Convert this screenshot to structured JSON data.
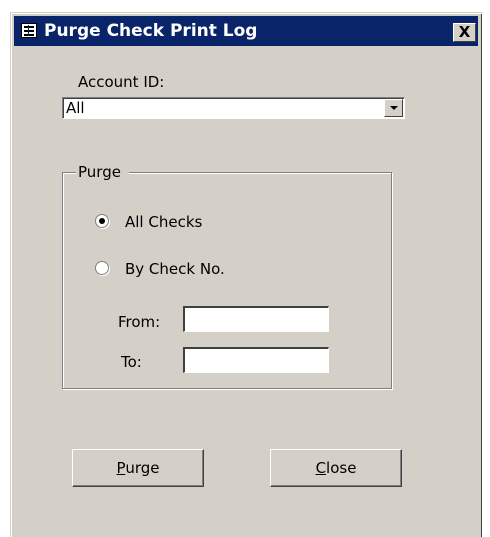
{
  "window": {
    "title": "Purge Check Print Log",
    "close_glyph": "X",
    "icon": "form-icon"
  },
  "account": {
    "label": "Account ID:",
    "selected": "All"
  },
  "purge_group": {
    "legend": "Purge",
    "options": [
      {
        "label": "All Checks",
        "selected": true
      },
      {
        "label": "By Check No.",
        "selected": false
      }
    ],
    "from_label": "From:",
    "from_value": "",
    "to_label": "To:",
    "to_value": ""
  },
  "buttons": {
    "purge": {
      "mnemonic": "P",
      "rest": "urge"
    },
    "close": {
      "mnemonic": "C",
      "rest": "lose"
    }
  }
}
